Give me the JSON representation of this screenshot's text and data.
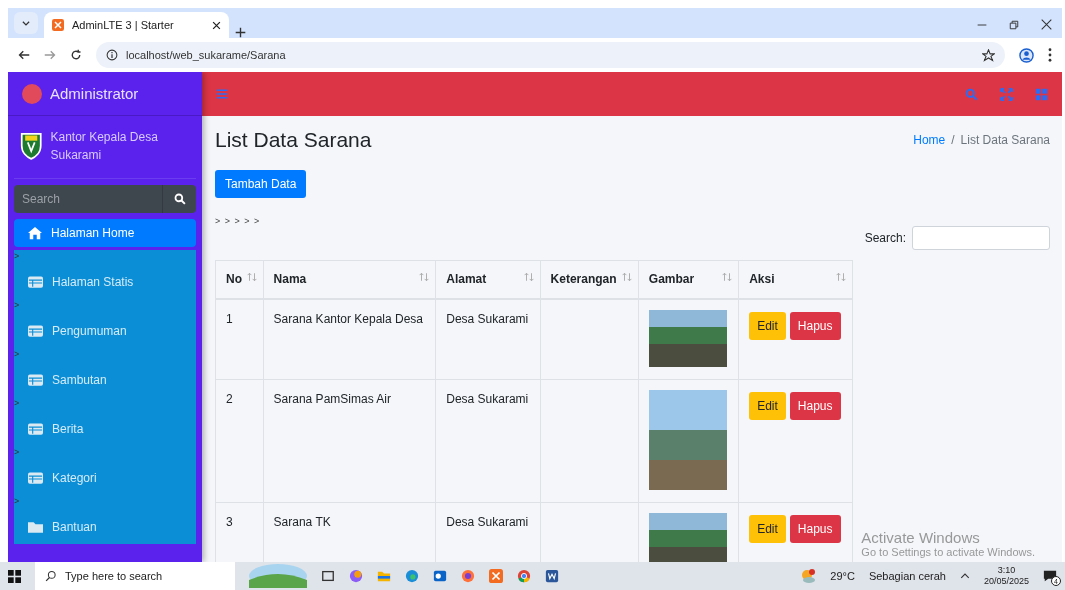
{
  "browser": {
    "tab_title": "AdminLTE 3 | Starter",
    "url": "localhost/web_sukarame/Sarana"
  },
  "sidebar": {
    "brand": "Administrator",
    "org_name": "Kantor Kepala Desa Sukarami",
    "search": {
      "placeholder": "Search"
    },
    "items": [
      {
        "label": "Halaman Home",
        "kind": "home",
        "selected": true
      },
      {
        "marker": ">",
        "label": "Halaman Statis",
        "kind": "table",
        "selected": false
      },
      {
        "marker": ">",
        "label": "Pengumuman",
        "kind": "table",
        "selected": false
      },
      {
        "marker": ">",
        "label": "Sambutan",
        "kind": "table",
        "selected": false
      },
      {
        "marker": ">",
        "label": "Berita",
        "kind": "table",
        "selected": false
      },
      {
        "marker": ">",
        "label": "Kategori",
        "kind": "table",
        "selected": false
      },
      {
        "marker": ">",
        "label": "Bantuan",
        "kind": "folder",
        "selected": false
      }
    ]
  },
  "content": {
    "title": "List Data Sarana",
    "breadcrumb": [
      {
        "label": "Home",
        "active": false
      },
      {
        "separator": "/",
        "label": "List Data Sarana",
        "active": true
      }
    ],
    "add_button": "Tambah Data",
    "pager": "> > > > >",
    "search_label": "Search:",
    "table": {
      "columns": [
        "No",
        "Nama",
        "Alamat",
        "Keterangan",
        "Gambar",
        "Aksi"
      ],
      "rows": [
        {
          "no": "1",
          "nama": "Sarana Kantor Kepala Desa",
          "alamat": "Desa Sukarami",
          "actions": [
            "Edit",
            "Hapus"
          ]
        },
        {
          "no": "2",
          "nama": "Sarana PamSimas Air",
          "alamat": "Desa Sukarami",
          "actions": [
            "Edit",
            "Hapus"
          ]
        },
        {
          "no": "3",
          "nama": "Sarana TK",
          "alamat": "Desa Sukarami",
          "actions": [
            "Edit",
            "Hapus"
          ]
        }
      ]
    }
  },
  "activation": {
    "title": "Activate Windows",
    "subtitle": "Go to Settings to activate Windows."
  },
  "taskbar": {
    "search_placeholder": "Type here to search",
    "temperature": "29°C",
    "weather": "Sebagian cerah",
    "time": "3:10",
    "date": "20/05/2025",
    "notifications": "4"
  }
}
